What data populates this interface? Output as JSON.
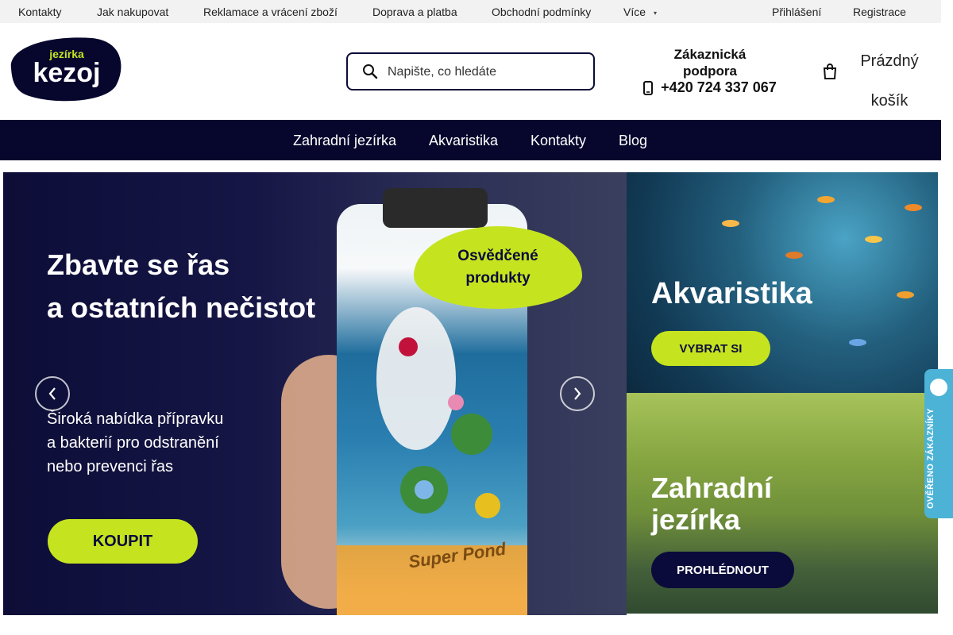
{
  "topbar": {
    "links": [
      "Kontakty",
      "Jak nakupovat",
      "Reklamace a vrácení zboží",
      "Doprava a platba",
      "Obchodní podmínky"
    ],
    "more_label": "Více",
    "login_label": "Přihlášení",
    "register_label": "Registrace"
  },
  "logo": {
    "small_text": "jezírka",
    "big_text": "kezoj"
  },
  "search": {
    "placeholder": "Napište, co hledáte"
  },
  "support": {
    "title_line1": "Zákaznická",
    "title_line2": "podpora",
    "phone": "+420 724 337 067"
  },
  "cart": {
    "line1": "Prázdný",
    "line2": "košík"
  },
  "mainnav": {
    "items": [
      "Zahradní jezírka",
      "Akvaristika",
      "Kontakty",
      "Blog"
    ]
  },
  "hero": {
    "title_line1": "Zbavte se řas",
    "title_line2": "a ostatních nečistot",
    "subtitle_line1": "Široká nabídka přípravku",
    "subtitle_line2": "a bakterií pro odstranění",
    "subtitle_line3": "nebo prevenci řas",
    "badge_line1": "Osvědčené",
    "badge_line2": "produkty",
    "button_label": "KOUPIT",
    "product_label": "Super Pond"
  },
  "banner_aquaristics": {
    "title": "Akvaristika",
    "button_label": "VYBRAT SI"
  },
  "banner_ponds": {
    "title_line1": "Zahradní",
    "title_line2": "jezírka",
    "button_label": "PROHLÉDNOUT"
  },
  "verified": {
    "label": "OVĚŘENO ZÁKAZNÍKY"
  },
  "colors": {
    "navy": "#07072e",
    "lime": "#c5e41f",
    "verified_blue": "#4cb3d6"
  }
}
